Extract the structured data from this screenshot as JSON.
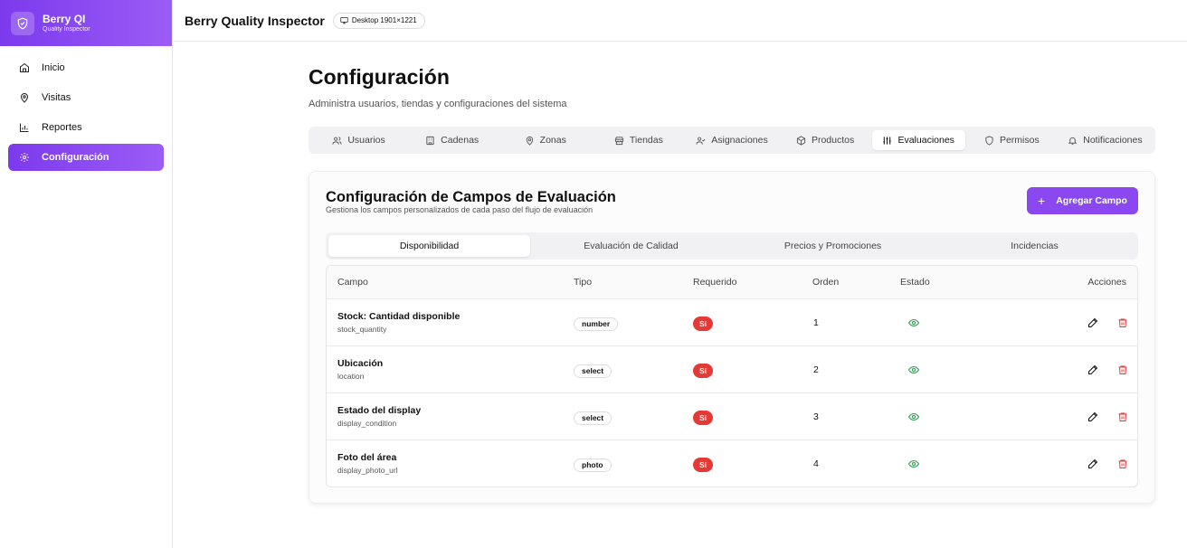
{
  "brand": {
    "name": "Berry QI",
    "subtitle": "Quality Inspector"
  },
  "topbar": {
    "title": "Berry Quality Inspector",
    "viewport": "Desktop 1901×1221"
  },
  "sidebar": {
    "items": [
      {
        "label": "Inicio",
        "icon": "home-icon"
      },
      {
        "label": "Visitas",
        "icon": "map-pin-icon"
      },
      {
        "label": "Reportes",
        "icon": "bar-chart-icon"
      },
      {
        "label": "Configuración",
        "icon": "gear-icon",
        "active": true
      }
    ]
  },
  "page": {
    "title": "Configuración",
    "subtitle": "Administra usuarios, tiendas y configuraciones del sistema"
  },
  "tabs": [
    {
      "label": "Usuarios",
      "icon": "users-icon"
    },
    {
      "label": "Cadenas",
      "icon": "store-chain-icon"
    },
    {
      "label": "Zonas",
      "icon": "map-pin-icon"
    },
    {
      "label": "Tiendas",
      "icon": "store-icon"
    },
    {
      "label": "Asignaciones",
      "icon": "user-check-icon"
    },
    {
      "label": "Productos",
      "icon": "box-icon"
    },
    {
      "label": "Evaluaciones",
      "icon": "sliders-icon",
      "active": true
    },
    {
      "label": "Permisos",
      "icon": "shield-icon"
    },
    {
      "label": "Notificaciones",
      "icon": "bell-icon"
    }
  ],
  "card": {
    "title": "Configuración de Campos de Evaluación",
    "subtitle": "Gestiona los campos personalizados de cada paso del flujo de evaluación",
    "add_button": "Agregar Campo"
  },
  "subtabs": [
    {
      "label": "Disponibilidad",
      "active": true
    },
    {
      "label": "Evaluación de Calidad"
    },
    {
      "label": "Precios y Promociones"
    },
    {
      "label": "Incidencias"
    }
  ],
  "table": {
    "headers": {
      "campo": "Campo",
      "tipo": "Tipo",
      "requerido": "Requerido",
      "orden": "Orden",
      "estado": "Estado",
      "acciones": "Acciones"
    },
    "rows": [
      {
        "name": "Stock: Cantidad disponible",
        "key": "stock_quantity",
        "type": "number",
        "required": "Sí",
        "order": "1"
      },
      {
        "name": "Ubicación",
        "key": "location",
        "type": "select",
        "required": "Sí",
        "order": "2"
      },
      {
        "name": "Estado del display",
        "key": "display_condition",
        "type": "select",
        "required": "Sí",
        "order": "3"
      },
      {
        "name": "Foto del área",
        "key": "display_photo_url",
        "type": "photo",
        "required": "Sí",
        "order": "4"
      }
    ]
  },
  "colors": {
    "accent": "#8b48f0",
    "danger": "#e53935",
    "success": "#2e9e4f"
  }
}
